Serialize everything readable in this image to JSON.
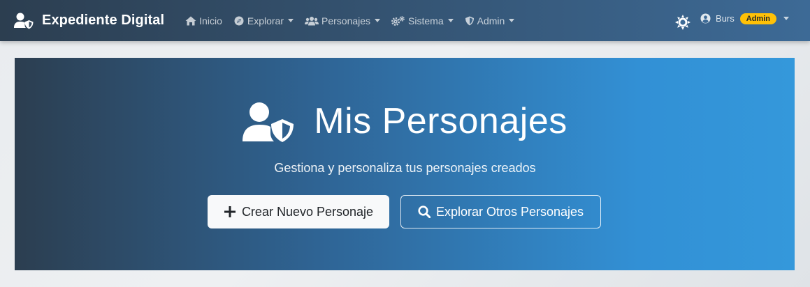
{
  "navbar": {
    "brand": "Expediente Digital",
    "items": [
      {
        "label": "Inicio",
        "icon": "home-icon",
        "dropdown": false
      },
      {
        "label": "Explorar",
        "icon": "compass-icon",
        "dropdown": true
      },
      {
        "label": "Personajes",
        "icon": "users-icon",
        "dropdown": true
      },
      {
        "label": "Sistema",
        "icon": "cogs-icon",
        "dropdown": true
      },
      {
        "label": "Admin",
        "icon": "shield-icon",
        "dropdown": true
      }
    ],
    "user": {
      "name": "Burs",
      "role_badge": "Admin"
    }
  },
  "hero": {
    "title": "Mis Personajes",
    "subtitle": "Gestiona y personaliza tus personajes creados",
    "primary_button": "Crear Nuevo Personaje",
    "secondary_button": "Explorar Otros Personajes"
  },
  "colors": {
    "navbar_start": "#2c3e50",
    "navbar_end": "#3d6a96",
    "hero_start": "#2c3e50",
    "hero_end": "#3498db",
    "badge": "#ffc107"
  }
}
